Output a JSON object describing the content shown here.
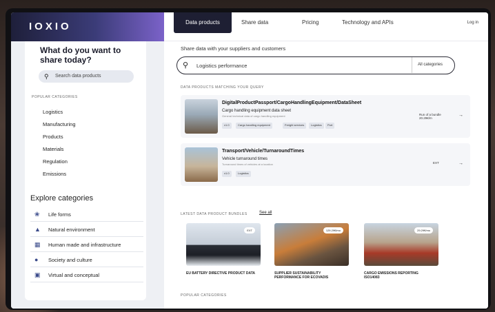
{
  "brand": {
    "logo": "IOXIO"
  },
  "nav": {
    "tabs": [
      "Data products",
      "Share data",
      "Pricing",
      "Technology and APIs"
    ],
    "login": "Log in"
  },
  "sidebar": {
    "title": "What do you want to share today?",
    "search_placeholder": "Search data products",
    "popular_label": "POPULAR CATEGORIES",
    "categories": [
      "Logistics",
      "Manufacturing",
      "Products",
      "Materials",
      "Regulation",
      "Emissions"
    ],
    "explore_title": "Explore categories",
    "explore_items": [
      {
        "label": "Life forms",
        "icon": "leaf-icon"
      },
      {
        "label": "Natural environment",
        "icon": "mountain-icon"
      },
      {
        "label": "Human made and infrastructure",
        "icon": "building-icon"
      },
      {
        "label": "Society and culture",
        "icon": "people-icon"
      },
      {
        "label": "Virtual and conceptual",
        "icon": "cube-icon"
      }
    ]
  },
  "main": {
    "subtitle": "Share data with your suppliers and customers",
    "search_value": "Logistics performance",
    "category_select": "All categories",
    "results_label": "DATA PRODUCTS MATCHING YOUR QUERY",
    "products": [
      {
        "title": "DigitalProductPassport/CargoHandlingEquipment/DataSheet",
        "subtitle": "Cargo handling equipment data sheet",
        "desc": "General technical data of cargo handling equipment",
        "tags": [
          "v1.0",
          "Cargo handling equipment",
          "Freight services",
          "Logistics",
          "Port"
        ],
        "price": "Run of a bundle 20.29€/m",
        "arrow": "→"
      },
      {
        "title": "Transport/Vehicle/TurnaroundTimes",
        "subtitle": "Vehicle turnaround times",
        "desc": "Turnaround times of vehicles at a location",
        "tags": [
          "v1.0",
          "Logistics"
        ],
        "price": "EXT",
        "arrow": "→"
      }
    ],
    "bundles_label": "LATEST DATA PRODUCT BUNDLES",
    "see_all": "See all",
    "bundles": [
      {
        "title": "EU BATTERY DIRECTIVE PRODUCT DATA",
        "badge": "EXT"
      },
      {
        "title": "SUPPLIER SUSTAINABILITY PERFORMANCE FOR ECOVADIS",
        "badge": "129.29€/mo"
      },
      {
        "title": "CARGO EMISSIONS REPORTING ISO14083",
        "badge": "29.29€/mo"
      }
    ],
    "popular_label": "POPULAR CATEGORIES"
  },
  "colors": {
    "brand_dark": "#1e1f33",
    "brand_purple": "#7b62c9",
    "sidebar_bg": "#eef0f4"
  }
}
